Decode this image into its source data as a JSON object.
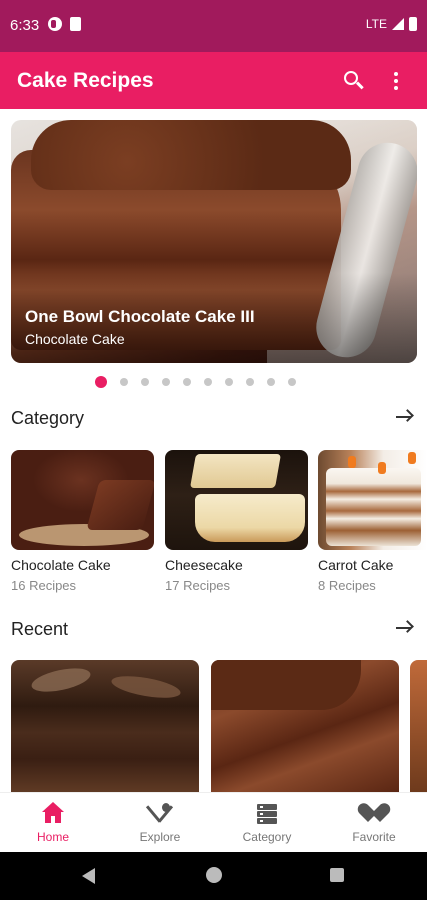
{
  "status_bar": {
    "time": "6:33",
    "network": "LTE"
  },
  "app_bar": {
    "title": "Cake Recipes"
  },
  "featured": {
    "title": "One Bowl Chocolate Cake III",
    "subtitle": "Chocolate Cake",
    "page_count": 10,
    "active_page": 1
  },
  "category_section": {
    "title": "Category",
    "items": [
      {
        "name": "Chocolate Cake",
        "count": "16 Recipes"
      },
      {
        "name": "Cheesecake",
        "count": "17 Recipes"
      },
      {
        "name": "Carrot Cake",
        "count": "8 Recipes"
      }
    ]
  },
  "recent_section": {
    "title": "Recent"
  },
  "bottom_nav": {
    "items": [
      {
        "label": "Home",
        "icon": "home-icon",
        "active": true
      },
      {
        "label": "Explore",
        "icon": "fork-spoon-icon",
        "active": false
      },
      {
        "label": "Category",
        "icon": "category-list-icon",
        "active": false
      },
      {
        "label": "Favorite",
        "icon": "heart-icon",
        "active": false
      }
    ]
  },
  "colors": {
    "status_bar": "#a11a5c",
    "primary": "#e91e63",
    "inactive_icon": "#555555"
  }
}
